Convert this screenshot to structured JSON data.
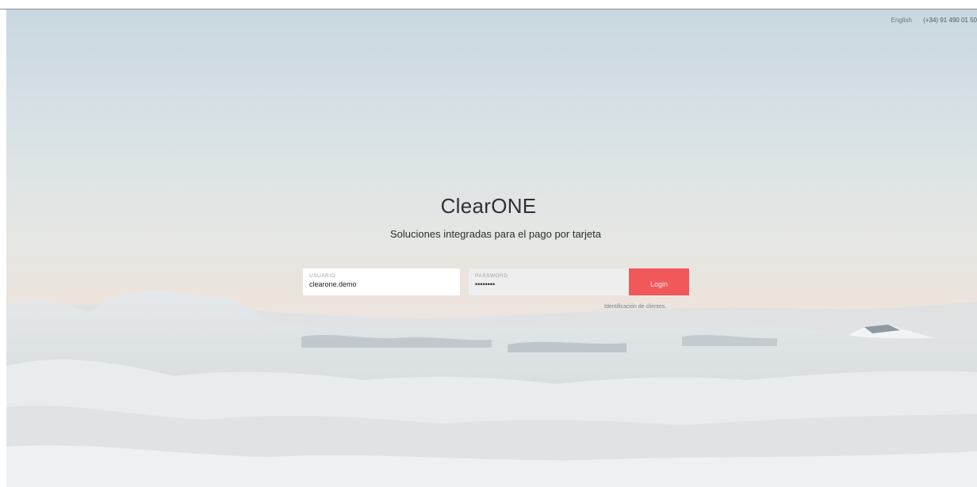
{
  "topbar": {
    "language": "English",
    "phone": "(+34) 91 490 01 50"
  },
  "hero": {
    "brand": "ClearONE",
    "tagline": "Soluciones integradas para el pago por tarjeta"
  },
  "login": {
    "username_label": "USUARIO",
    "username_value": "clearone.demo",
    "password_label": "PASSWORD",
    "password_value": "demodemo",
    "button_label": "Login",
    "client_link": "Identificación de clientes."
  },
  "colors": {
    "accent": "#f0585a",
    "text_dark": "#2d3236"
  },
  "icons": {
    "background": "clouds-mountains-image"
  }
}
